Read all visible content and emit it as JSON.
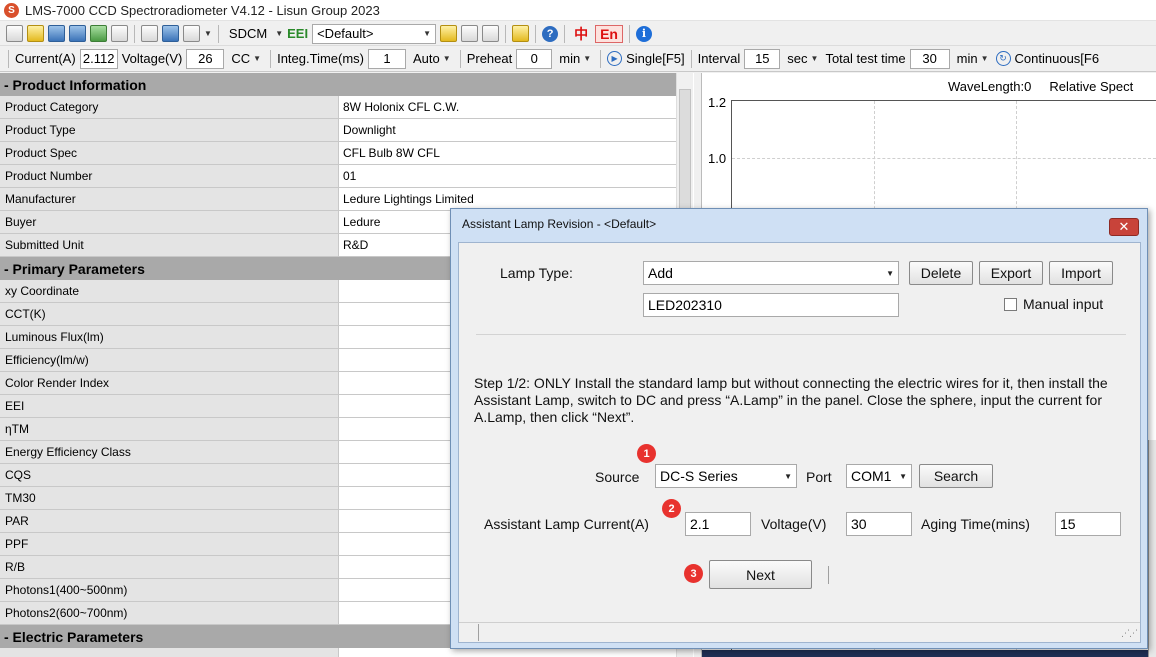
{
  "window": {
    "title": "LMS-7000 CCD Spectroradiometer V4.12 - Lisun Group 2023",
    "logo_letter": "S"
  },
  "toolbar": {
    "sdcm_label": "SDCM",
    "eei_label": "EEI",
    "default_combo": "<Default>",
    "cn_label": "中",
    "en_label": "En",
    "help_label": "?",
    "info_label": "i"
  },
  "params": {
    "current_label": "Current(A)",
    "current_value": "2.112",
    "voltage_label": "Voltage(V)",
    "voltage_value": "26",
    "cc_label": "CC",
    "integ_label": "Integ.Time(ms)",
    "integ_value": "1",
    "auto_label": "Auto",
    "preheat_label": "Preheat",
    "preheat_value": "0",
    "preheat_unit": "min",
    "single_label": "Single[F5]",
    "interval_label": "Interval",
    "interval_value": "15",
    "interval_unit": "sec",
    "total_label": "Total test time",
    "total_value": "30",
    "total_unit": "min",
    "continuous_label": "Continuous[F6"
  },
  "product_info": {
    "header": "- Product Information",
    "rows": [
      {
        "label": "Product Category",
        "value": "8W Holonix CFL C.W."
      },
      {
        "label": "Product Type",
        "value": "Downlight"
      },
      {
        "label": "Product Spec",
        "value": "CFL Bulb  8W CFL"
      },
      {
        "label": "Product Number",
        "value": "01"
      },
      {
        "label": "Manufacturer",
        "value": "Ledure Lightings Limited"
      },
      {
        "label": "Buyer",
        "value": "Ledure"
      },
      {
        "label": "Submitted Unit",
        "value": "R&D"
      }
    ]
  },
  "primary_params": {
    "header": "- Primary Parameters",
    "rows": [
      {
        "label": "xy Coordinate",
        "value": ""
      },
      {
        "label": "CCT(K)",
        "value": ""
      },
      {
        "label": "Luminous Flux(lm)",
        "value": ""
      },
      {
        "label": "Efficiency(lm/w)",
        "value": ""
      },
      {
        "label": "Color Render Index",
        "value": ""
      },
      {
        "label": "EEI",
        "value": ""
      },
      {
        "label": "ηTM",
        "value": ""
      },
      {
        "label": "Energy Efficiency Class",
        "value": ""
      },
      {
        "label": "CQS",
        "value": ""
      },
      {
        "label": "TM30",
        "value": ""
      },
      {
        "label": "PAR",
        "value": ""
      },
      {
        "label": "PPF",
        "value": ""
      },
      {
        "label": "R/B",
        "value": ""
      },
      {
        "label": "Photons1(400~500nm)",
        "value": ""
      },
      {
        "label": "Photons2(600~700nm)",
        "value": ""
      }
    ]
  },
  "electric_params": {
    "header": "- Electric Parameters"
  },
  "chart": {
    "wavelength_label": "WaveLength:0",
    "spectrum_label": "Relative Spect",
    "y_ticks": [
      "1.2",
      "1.0"
    ]
  },
  "dialog": {
    "title": "Assistant Lamp Revision - <Default>",
    "close_label": "✕",
    "lamp_type_label": "Lamp Type:",
    "lamp_type_value": "Add",
    "delete_label": "Delete",
    "export_label": "Export",
    "import_label": "Import",
    "lamp_name_value": "LED202310",
    "manual_input_label": "Manual input",
    "step_text": "Step 1/2: ONLY Install the standard lamp but without connecting the electric wires for it, then install the Assistant Lamp, switch to DC and press “A.Lamp” in the panel. Close the sphere, input the current for A.Lamp, then click “Next”.",
    "source_label": "Source",
    "source_value": "DC-S Series",
    "port_label": "Port",
    "port_value": "COM1",
    "search_label": "Search",
    "current_label": "Assistant Lamp Current(A)",
    "current_value": "2.1",
    "voltage_label": "Voltage(V)",
    "voltage_value": "30",
    "aging_label": "Aging Time(mins)",
    "aging_value": "15",
    "next_label": "Next",
    "badges": [
      "1",
      "2",
      "3"
    ]
  }
}
